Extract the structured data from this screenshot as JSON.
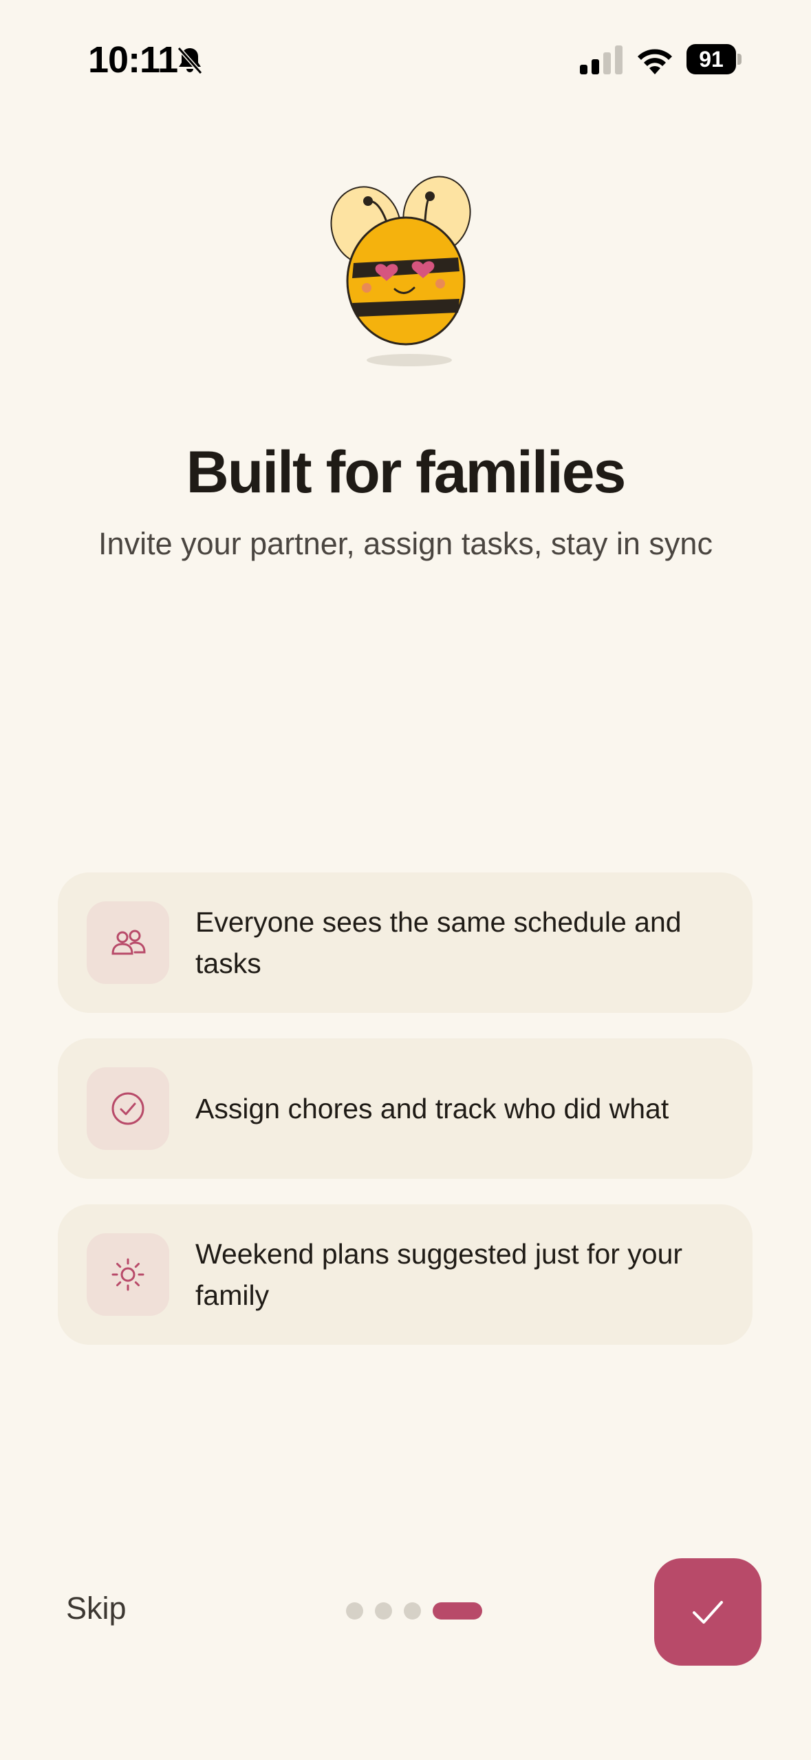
{
  "status_bar": {
    "time": "10:11",
    "battery_level": "91",
    "icons": [
      "bell-muted-icon",
      "cellular-signal-icon",
      "wifi-icon",
      "battery-icon"
    ]
  },
  "mascot": {
    "icon": "bee-mascot-icon"
  },
  "header": {
    "title": "Built for families",
    "subtitle": "Invite your partner, assign tasks, stay in sync"
  },
  "features": [
    {
      "icon": "people-icon",
      "text": "Everyone sees the same schedule and tasks"
    },
    {
      "icon": "check-circle-icon",
      "text": "Assign chores and track who did what"
    },
    {
      "icon": "sun-icon",
      "text": "Weekend plans suggested just for your family"
    }
  ],
  "footer": {
    "skip_label": "Skip",
    "pager": {
      "total": 4,
      "current": 4
    },
    "next_icon": "checkmark-icon"
  },
  "colors": {
    "background": "#FAF6EE",
    "card": "#F4EEE1",
    "icon_tile": "#F0E0D8",
    "accent": "#B84A69",
    "text": "#1F1B16",
    "inactive_dot": "#D6D1C7"
  }
}
